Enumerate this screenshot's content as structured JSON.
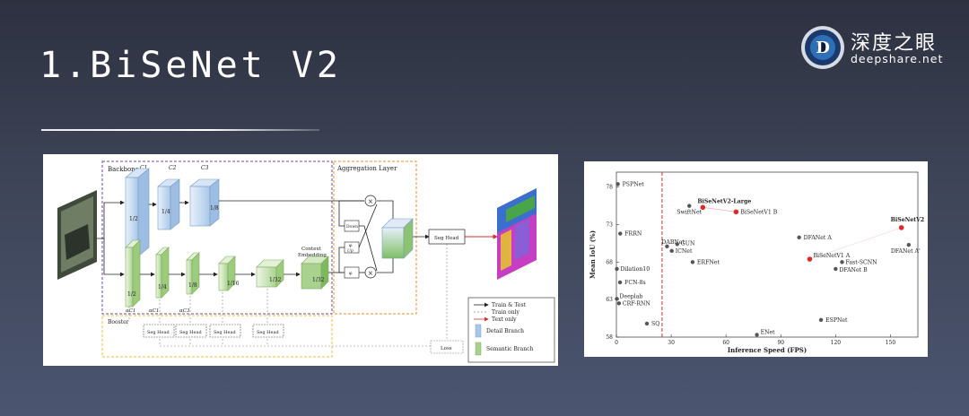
{
  "slide": {
    "title": "1.BiSeNet V2",
    "logo": {
      "cn": "深度之眼",
      "en": "deepshare.net",
      "badge_letter": "D"
    }
  },
  "diagram": {
    "backbone": "Backbone",
    "channels": [
      "C1",
      "C2",
      "C3"
    ],
    "aggregation": "Aggregation Layer",
    "detail_scales": [
      "1/2",
      "1/4",
      "1/8"
    ],
    "semantic_scales": [
      "1/2",
      "1/4",
      "1/8",
      "1/16",
      "1/32",
      "1/32"
    ],
    "semantic_channels": [
      "αC1",
      "αC1",
      "αC3"
    ],
    "context": [
      "Context",
      "Embedding"
    ],
    "down": "Down",
    "psi": [
      "φ",
      "φ"
    ],
    "up": "Up",
    "seg_head": "Seg Head",
    "booster": "Booster",
    "booster_heads": [
      "Seg Head",
      "Seg Head",
      "Seg Head",
      "Seg Head"
    ],
    "loss": "Loss",
    "legend": [
      "Train & Test",
      "Train only",
      "Text only",
      "Detail Branch",
      "Semantic Branch"
    ]
  },
  "chart_data": {
    "type": "scatter",
    "title": "",
    "xlabel": "Inference Speed (FPS)",
    "ylabel": "Mean IoU (%)",
    "xlim": [
      0,
      165
    ],
    "ylim": [
      58,
      80
    ],
    "xticks": [
      0,
      30,
      60,
      90,
      120,
      150
    ],
    "yticks": [
      58,
      63,
      68,
      73,
      78
    ],
    "realtime_line_x": 25,
    "points": [
      {
        "label": "PSPNet",
        "x": 0.8,
        "y": 78.4,
        "highlight": false
      },
      {
        "label": "BiSeNetV2-Large",
        "x": 47.3,
        "y": 75.3,
        "highlight": true
      },
      {
        "label": "SwiftNet",
        "x": 39.9,
        "y": 75.5,
        "highlight": false
      },
      {
        "label": "BiSeNetV1 B",
        "x": 65.5,
        "y": 74.7,
        "highlight": true
      },
      {
        "label": "BiSeNetV2",
        "x": 156,
        "y": 72.6,
        "highlight": true
      },
      {
        "label": "DFANet A'",
        "x": 160,
        "y": 70.3,
        "highlight": false
      },
      {
        "label": "FRRN",
        "x": 2.1,
        "y": 71.8,
        "highlight": false
      },
      {
        "label": "DABNet",
        "x": 27.7,
        "y": 70.1,
        "highlight": false
      },
      {
        "label": "GUN",
        "x": 33.3,
        "y": 70.4,
        "highlight": false
      },
      {
        "label": "ICNet",
        "x": 30.3,
        "y": 69.5,
        "highlight": false
      },
      {
        "label": "DFANet A",
        "x": 100,
        "y": 71.3,
        "highlight": false
      },
      {
        "label": "BiSeNetV1 A",
        "x": 105.8,
        "y": 68.4,
        "highlight": true
      },
      {
        "label": "Fast-SCNN",
        "x": 123.5,
        "y": 68.0,
        "highlight": false
      },
      {
        "label": "DFANet B",
        "x": 120,
        "y": 67.1,
        "highlight": false
      },
      {
        "label": "ERFNet",
        "x": 41.7,
        "y": 68.0,
        "highlight": false
      },
      {
        "label": "Dilation10",
        "x": 0.25,
        "y": 67.1,
        "highlight": false
      },
      {
        "label": "FCN-8s",
        "x": 2.0,
        "y": 65.3,
        "highlight": false
      },
      {
        "label": "Deeplab",
        "x": 0.25,
        "y": 63.1,
        "highlight": false
      },
      {
        "label": "CRF-RNN",
        "x": 1.4,
        "y": 62.5,
        "highlight": false
      },
      {
        "label": "SQ",
        "x": 16.7,
        "y": 59.8,
        "highlight": false
      },
      {
        "label": "ENet",
        "x": 76.9,
        "y": 58.3,
        "highlight": false
      },
      {
        "label": "ESPNet",
        "x": 112,
        "y": 60.3,
        "highlight": false
      }
    ]
  }
}
